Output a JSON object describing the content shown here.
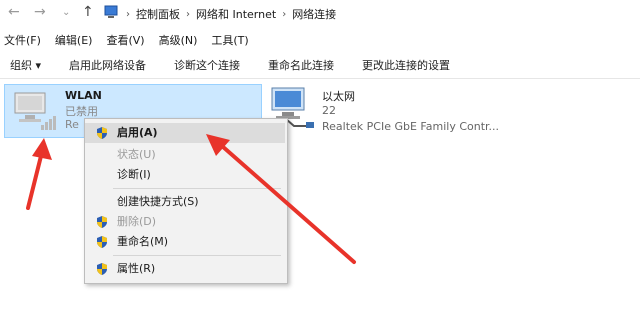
{
  "address_bar": {
    "breadcrumbs": [
      "控制面板",
      "网络和 Internet",
      "网络连接"
    ]
  },
  "menu": [
    "文件(F)",
    "编辑(E)",
    "查看(V)",
    "高级(N)",
    "工具(T)"
  ],
  "toolbar": [
    "组织 ▾",
    "启用此网络设备",
    "诊断这个连接",
    "重命名此连接",
    "更改此连接的设置"
  ],
  "adapters": {
    "wlan": {
      "name": "WLAN",
      "status": "已禁用",
      "device": "Re"
    },
    "ethernet": {
      "name": "以太网",
      "network": "22",
      "device": "Realtek PCIe GbE Family Contr..."
    }
  },
  "context_menu": {
    "items": [
      {
        "label": "启用(A)",
        "shield": true,
        "disabled": false,
        "bold": true
      },
      {
        "label": "状态(U)",
        "shield": false,
        "disabled": true
      },
      {
        "label": "诊断(I)",
        "shield": false,
        "disabled": false
      },
      {
        "label": "创建快捷方式(S)",
        "shield": false,
        "disabled": false
      },
      {
        "label": "删除(D)",
        "shield": true,
        "disabled": true
      },
      {
        "label": "重命名(M)",
        "shield": true,
        "disabled": false
      },
      {
        "label": "属性(R)",
        "shield": true,
        "disabled": false
      }
    ]
  },
  "colors": {
    "selection_bg": "#cce8ff",
    "annotation_arrow": "#e8332a"
  }
}
